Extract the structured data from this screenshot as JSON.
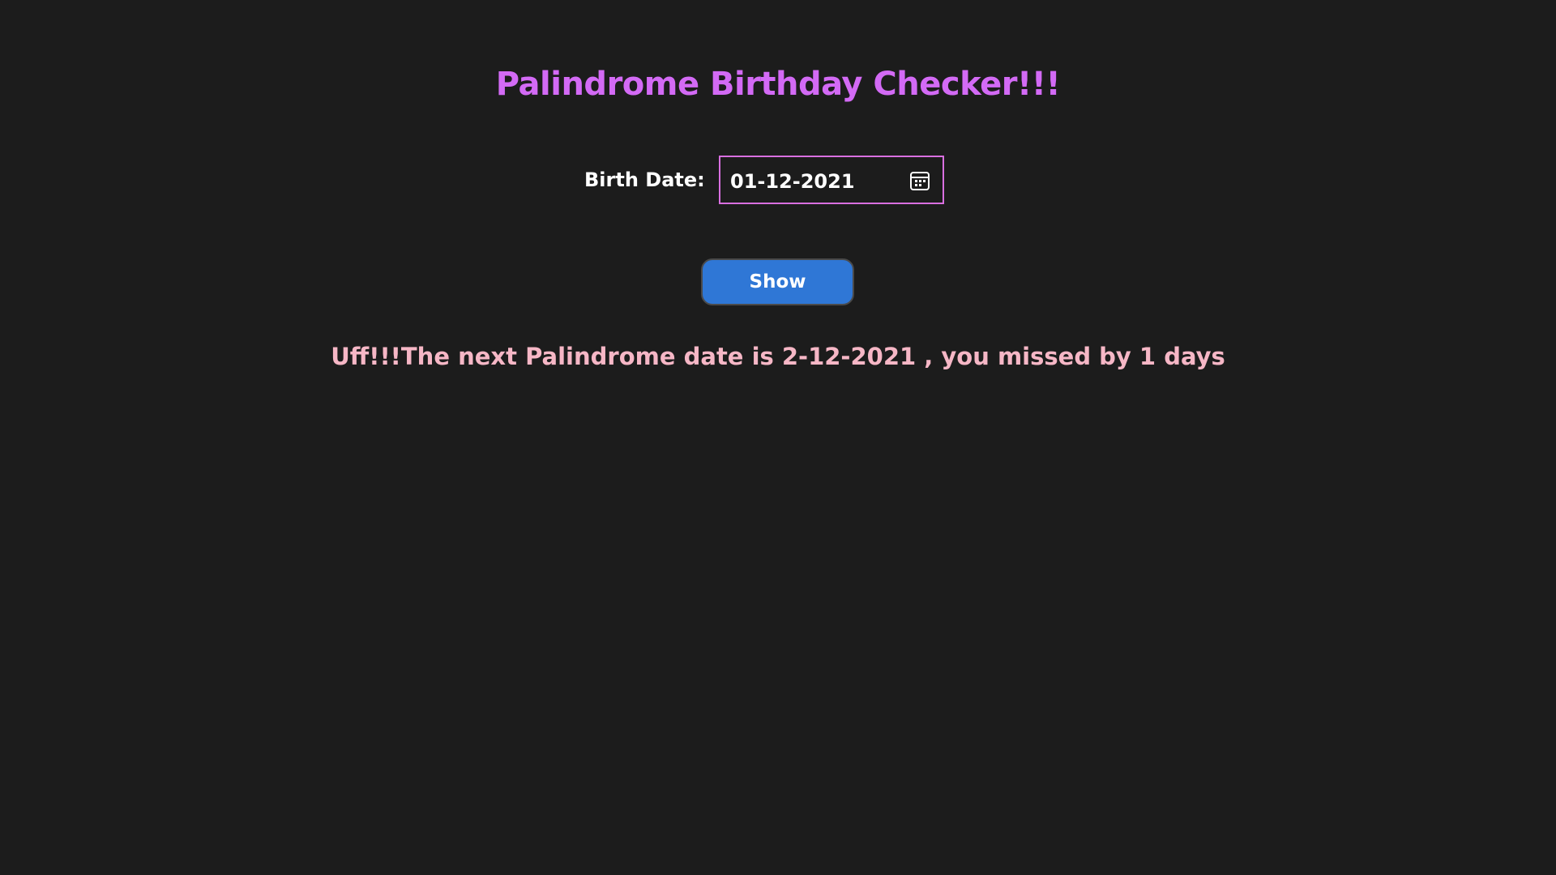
{
  "colors": {
    "background": "#1c1c1c",
    "title": "#d36af5",
    "result": "#f6b7c6",
    "button": "#2f77d6",
    "input_border": "#d96fe0"
  },
  "header": {
    "title": "Palindrome Birthday Checker!!!"
  },
  "form": {
    "birth_date_label": "Birth Date:",
    "birth_date_value": "01-12-2021",
    "calendar_icon": "calendar-icon"
  },
  "actions": {
    "show_label": "Show"
  },
  "output": {
    "message": "Uff!!!The next Palindrome date is 2-12-2021 , you missed by 1 days"
  }
}
